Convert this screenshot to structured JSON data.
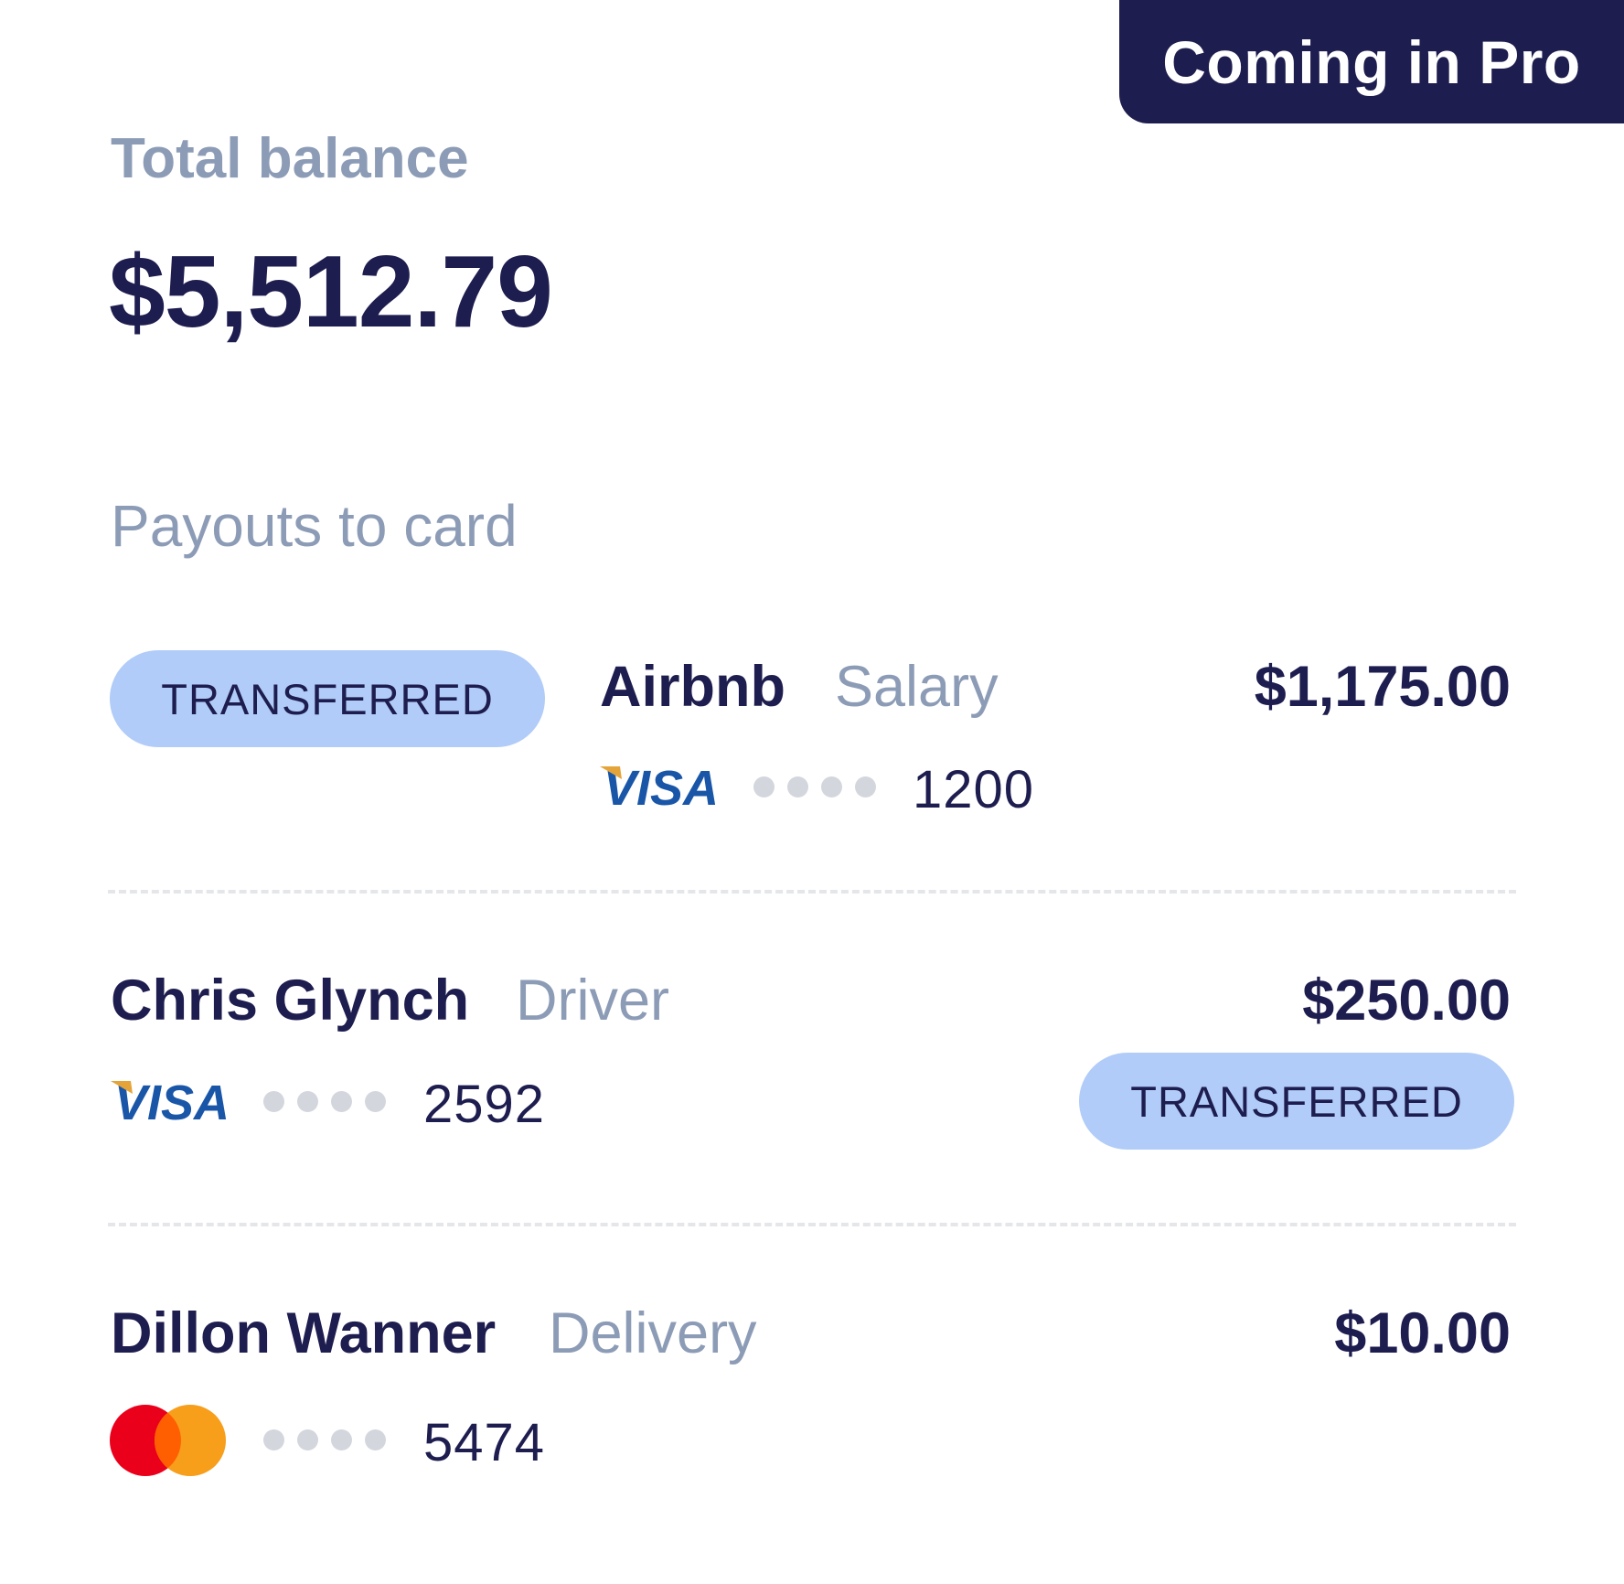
{
  "header": {
    "pro_badge": "Coming in Pro"
  },
  "balance": {
    "label": "Total balance",
    "amount": "$5,512.79"
  },
  "payouts": {
    "title": "Payouts to card",
    "items": [
      {
        "name": "Airbnb",
        "role": "Salary",
        "amount": "$1,175.00",
        "status": "TRANSFERRED",
        "card_brand": "VISA",
        "masked": "••••",
        "last4": "1200"
      },
      {
        "name": "Chris Glynch",
        "role": "Driver",
        "amount": "$250.00",
        "status": "TRANSFERRED",
        "card_brand": "VISA",
        "masked": "••••",
        "last4": "2592"
      },
      {
        "name": "Dillon Wanner",
        "role": "Delivery",
        "amount": "$10.00",
        "status": "",
        "card_brand": "mastercard",
        "masked": "••••",
        "last4": "5474"
      }
    ]
  },
  "colors": {
    "navy": "#1e1d4f",
    "muted": "#8d9cb6",
    "pill": "#b1ccf8",
    "visa_blue": "#1a56a8",
    "visa_gold": "#e4a43a",
    "mc_red": "#eb001b",
    "mc_orange": "#f79e1b"
  }
}
